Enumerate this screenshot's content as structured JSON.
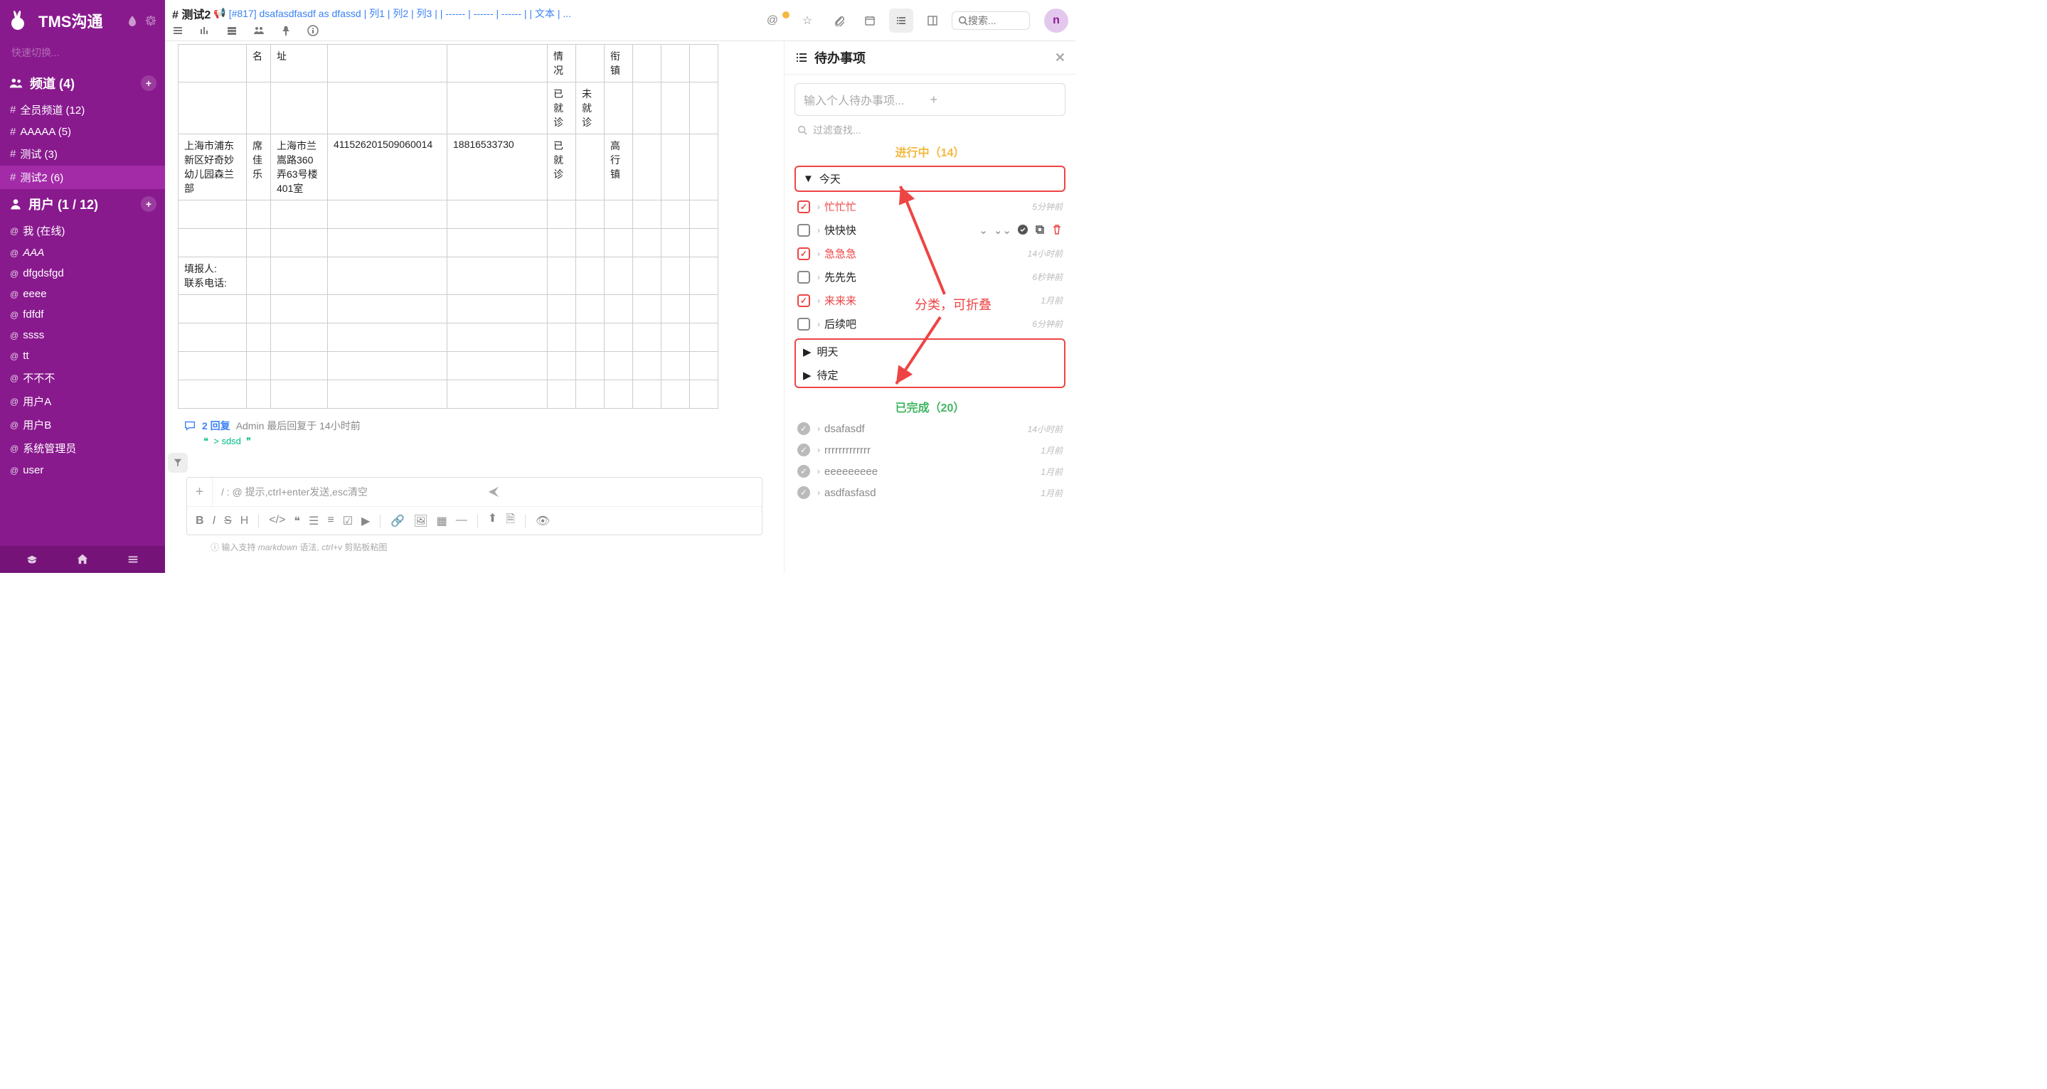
{
  "app_title": "TMS沟通",
  "quick_switch": "快速切换...",
  "sidebar": {
    "channels_header": "频道 (4)",
    "channels": [
      {
        "label": "全员频道 (12)"
      },
      {
        "label": "AAAAA (5)"
      },
      {
        "label": "测试 (3)"
      },
      {
        "label": "测试2 (6)",
        "active": true
      }
    ],
    "users_header": "用户 (1 / 12)",
    "users": [
      {
        "label": "我 (在线)"
      },
      {
        "label": "AAA",
        "italic": true
      },
      {
        "label": "dfgdsfgd"
      },
      {
        "label": "eeee"
      },
      {
        "label": "fdfdf"
      },
      {
        "label": "ssss"
      },
      {
        "label": "tt"
      },
      {
        "label": "不不不"
      },
      {
        "label": "用户A"
      },
      {
        "label": "用户B"
      },
      {
        "label": "系统管理员"
      },
      {
        "label": "user"
      }
    ]
  },
  "crumb": {
    "title": "# 测试2",
    "link": "[#817] dsafasdfasdf as dfassd | 列1 | 列2 | 列3 | | ------ | ------ | ------ | | 文本 | ..."
  },
  "search_placeholder": "搜索...",
  "avatar_letter": "n",
  "table": {
    "h_name": "名",
    "h_addr": "址",
    "h_status": "情况",
    "h_town": "衔镇",
    "r1_status": "已就诊",
    "r1_unstatus": "未就诊",
    "r2_school": "上海市浦东新区好奇妙幼儿园森兰部",
    "r2_name": "席佳乐",
    "r2_addr": "上海市兰嵩路360弄63号楼401室",
    "r2_id": "411526201509060014",
    "r2_phone": "18816533730",
    "r2_status": "已就诊",
    "r2_town": "高行镇",
    "r3_reporter": "填报人:",
    "r3_contact": "联系电话:"
  },
  "reply": {
    "count": "2 回复",
    "meta": "Admin 最后回复于 14小时前",
    "quote": "> sdsd"
  },
  "composer": {
    "placeholder": "/ : @ 提示,ctrl+enter发送,esc清空",
    "hint_pre": "输入支持 ",
    "hint_md": "markdown",
    "hint_mid": " 语法, ",
    "hint_cv": "ctrl+v",
    "hint_post": " 剪贴板粘图"
  },
  "todo": {
    "header": "待办事项",
    "input_placeholder": "输入个人待办事项...",
    "filter_placeholder": "过滤查找...",
    "in_progress": "进行中（14）",
    "completed": "已完成（20）",
    "groups": {
      "today": "今天",
      "tomorrow": "明天",
      "tbd": "待定"
    },
    "items_today": [
      {
        "label": "忙忙忙",
        "red": true,
        "time": "5分钟前"
      },
      {
        "label": "快快快",
        "red": false,
        "tools": true
      },
      {
        "label": "急急急",
        "red": true,
        "time": "14小时前"
      },
      {
        "label": "先先先",
        "red": false,
        "time": "6秒钟前"
      },
      {
        "label": "来来来",
        "red": true,
        "time": "1月前"
      },
      {
        "label": "后续吧",
        "red": false,
        "time": "6分钟前"
      }
    ],
    "items_done": [
      {
        "label": "dsafasdf",
        "time": "14小时前"
      },
      {
        "label": "rrrrrrrrrrrrr",
        "time": "1月前"
      },
      {
        "label": "eeeeeeeee",
        "time": "1月前"
      },
      {
        "label": "asdfasfasd",
        "time": "1月前"
      }
    ]
  },
  "annotation": "分类，可折叠"
}
